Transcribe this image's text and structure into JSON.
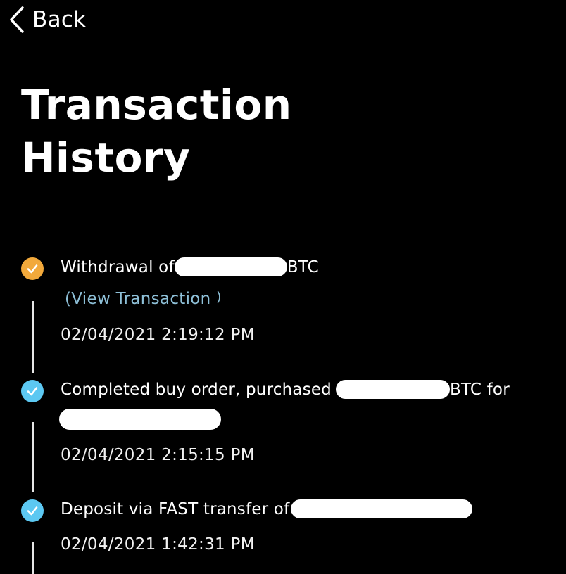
{
  "header": {
    "back_label": "Back",
    "back_icon": "chevron-left-icon"
  },
  "page": {
    "title_line1": "Transaction",
    "title_line2": "History"
  },
  "colors": {
    "pending": "#f2a93b",
    "completed": "#5cc8f2",
    "link": "#8ec0d8",
    "background": "#000000"
  },
  "transactions": [
    {
      "status": "pending",
      "icon": "check-circle-icon",
      "text_before": "Withdrawal of",
      "text_after": "BTC",
      "link_label": "(View Transaction ",
      "link_chevron": ")",
      "timestamp": "02/04/2021 2:19:12 PM"
    },
    {
      "status": "completed",
      "icon": "check-circle-icon",
      "text_before": "Completed buy order, purchased",
      "text_after": "BTC for",
      "timestamp": "02/04/2021 2:15:15 PM"
    },
    {
      "status": "completed",
      "icon": "check-circle-icon",
      "text_before": "Deposit via FAST transfer of",
      "timestamp": "02/04/2021 1:42:31 PM"
    }
  ]
}
